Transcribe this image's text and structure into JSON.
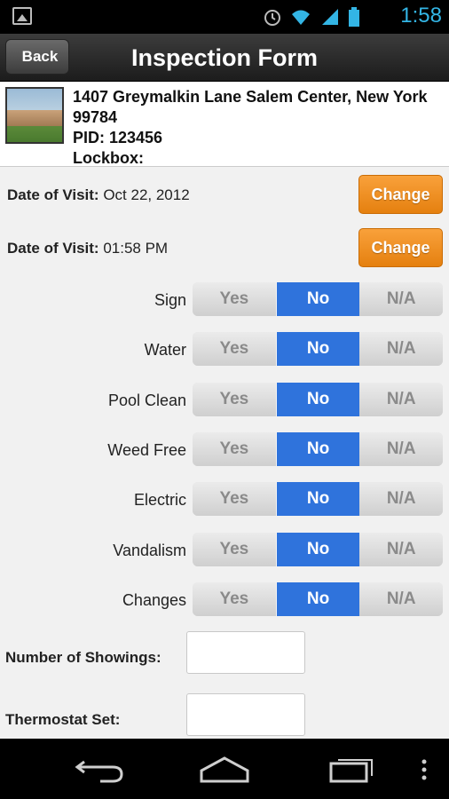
{
  "status_bar": {
    "time": "1:58",
    "icons": [
      "gallery-icon",
      "alarm-icon",
      "wifi-icon",
      "signal-icon",
      "battery-icon"
    ]
  },
  "header": {
    "back_label": "Back",
    "title": "Inspection Form"
  },
  "property": {
    "address": "1407 Greymalkin Lane Salem Center, New York 99784",
    "pid": "PID: 123456",
    "lockbox": "Lockbox:"
  },
  "dates": [
    {
      "label": "Date of Visit:",
      "value": "Oct 22, 2012",
      "button": "Change"
    },
    {
      "label": "Date of Visit:",
      "value": "01:58 PM",
      "button": "Change"
    }
  ],
  "options": [
    "Yes",
    "No",
    "N/A"
  ],
  "toggles": [
    {
      "label": "Sign",
      "selected": "No"
    },
    {
      "label": "Water",
      "selected": "No"
    },
    {
      "label": "Pool Clean",
      "selected": "No"
    },
    {
      "label": "Weed Free",
      "selected": "No"
    },
    {
      "label": "Electric",
      "selected": "No"
    },
    {
      "label": "Vandalism",
      "selected": "No"
    },
    {
      "label": "Changes",
      "selected": "No"
    }
  ],
  "fields": [
    {
      "label": "Number of Showings:",
      "value": ""
    },
    {
      "label": "Thermostat Set:",
      "value": ""
    }
  ],
  "colors": {
    "accent_blue": "#2f73dc",
    "change_orange": "#f39322",
    "time_blue": "#33b5e5"
  }
}
